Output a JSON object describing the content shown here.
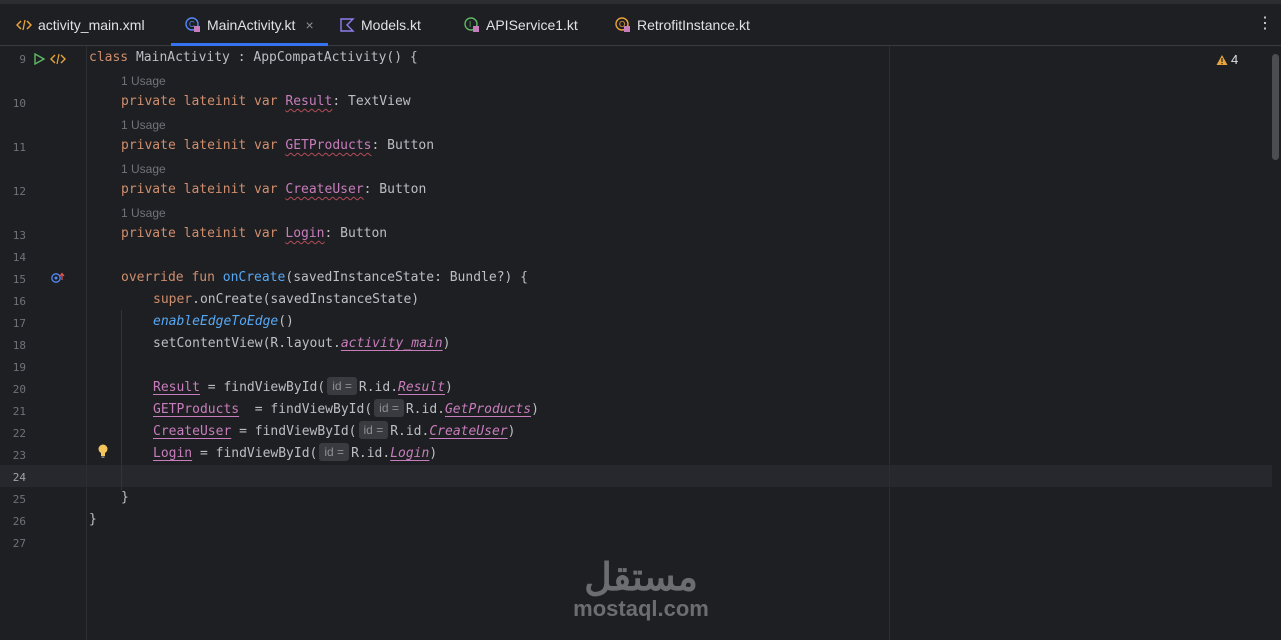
{
  "tabs": [
    {
      "label": "activity_main.xml",
      "icon": "xml-file-icon",
      "active": false
    },
    {
      "label": "MainActivity.kt",
      "icon": "kotlin-class-icon",
      "active": true
    },
    {
      "label": "Models.kt",
      "icon": "kotlin-file-icon",
      "active": false
    },
    {
      "label": "APIService1.kt",
      "icon": "kotlin-interface-icon",
      "active": false
    },
    {
      "label": "RetrofitInstance.kt",
      "icon": "kotlin-object-icon",
      "active": false
    }
  ],
  "tab_close": "×",
  "tab_menu": "⋮",
  "warnings": {
    "count": "4"
  },
  "usage_hint": "1 Usage",
  "param_hint": "id =",
  "line_numbers": [
    "9",
    "10",
    "11",
    "12",
    "13",
    "14",
    "15",
    "16",
    "17",
    "18",
    "19",
    "20",
    "21",
    "22",
    "23",
    "24",
    "25",
    "26",
    "27"
  ],
  "code": {
    "l9": {
      "kw": "class",
      "name": " MainActivity : AppCompatActivity() {"
    },
    "l10": {
      "kw": "private lateinit var",
      "prop": "Result",
      "type": ": TextView"
    },
    "l11": {
      "kw": "private lateinit var",
      "prop": "GETProducts",
      "type": ": Button"
    },
    "l12": {
      "kw": "private lateinit var",
      "prop": "CreateUser",
      "type": ": Button"
    },
    "l13": {
      "kw": "private lateinit var",
      "prop": "Login",
      "type": ": Button"
    },
    "l15": {
      "kw": "override fun",
      "fn": "onCreate",
      "rest": "(savedInstanceState: Bundle?) {"
    },
    "l16": {
      "kw": "super",
      "rest": ".onCreate(savedInstanceState)"
    },
    "l17": {
      "fn": "enableEdgeToEdge",
      "rest": "()"
    },
    "l18": {
      "pre": "setContentView(R.layout.",
      "prop": "activity_main",
      "rest": ")"
    },
    "l20": {
      "prop": "Result",
      "mid": " = findViewById(",
      "ref": "R.id.",
      "res": "Result",
      "rest": ")"
    },
    "l21": {
      "prop": "GETProducts",
      "mid": "  = findViewById(",
      "ref": "R.id.",
      "res": "GetProducts",
      "rest": ")"
    },
    "l22": {
      "prop": "CreateUser",
      "mid": " = findViewById(",
      "ref": "R.id.",
      "res": "CreateUser",
      "rest": ")"
    },
    "l23": {
      "prop": "Login",
      "mid": " = findViewById(",
      "ref": "R.id.",
      "res": "Login",
      "rest": ")"
    },
    "l25": "}",
    "l26": "}"
  },
  "watermark": {
    "arabic": "مستقل",
    "latin": "mostaql.com"
  }
}
